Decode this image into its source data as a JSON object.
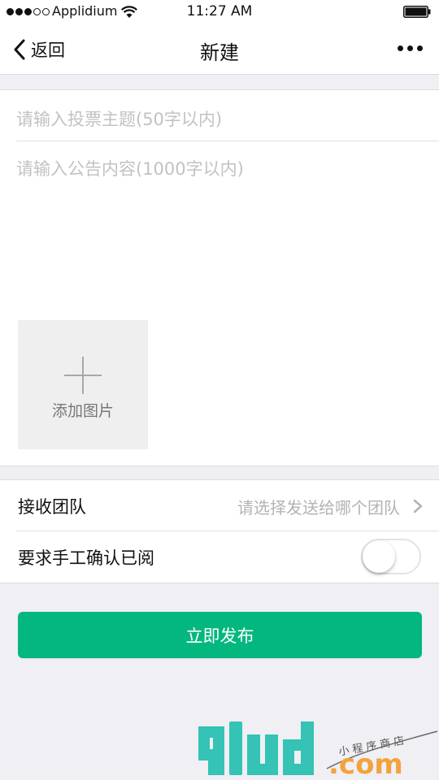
{
  "status_bar": {
    "carrier": "Applidium",
    "time": "11:27 AM"
  },
  "nav": {
    "back_label": "返回",
    "title": "新建"
  },
  "form": {
    "subject_placeholder": "请输入投票主题(50字以内)",
    "subject_value": "",
    "content_placeholder": "请输入公告内容(1000字以内)",
    "content_value": "",
    "add_image_label": "添加图片"
  },
  "settings": {
    "team_label": "接收团队",
    "team_placeholder": "请选择发送给哪个团队",
    "confirm_label": "要求手工确认已阅",
    "confirm_enabled": false
  },
  "publish_label": "立即发布",
  "watermark": {
    "text": "91ud.com 小程序商店"
  },
  "colors": {
    "primary": "#03b77f",
    "background": "#efeff4",
    "placeholder": "#c2c2c2"
  }
}
